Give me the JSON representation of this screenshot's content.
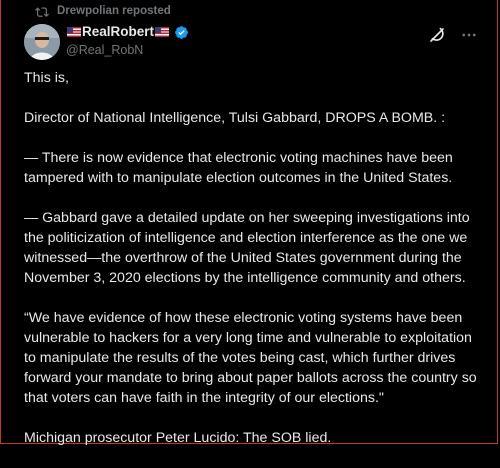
{
  "repost": {
    "icon": "repost-icon",
    "text": "Drewpolian reposted"
  },
  "author": {
    "display_name": "RealRobert",
    "handle": "@Real_RobN",
    "verified_color": "#1d9bf0"
  },
  "actions": {
    "grok_icon": "grok-icon",
    "more_icon": "more-icon"
  },
  "post": {
    "paragraphs": [
      "This is,",
      "Director of National Intelligence, Tulsi Gabbard, DROPS A BOMB. :",
      "— There is now evidence that electronic voting machines have been tampered with to manipulate election outcomes in the United States.",
      "— Gabbard gave a detailed update on her sweeping investigations into the politicization of intelligence and election interference as the one we witnessed—the overthrow of the United States government during the November 3, 2020 elections by the intelligence community and others.",
      "“We have evidence of how these electronic voting systems have been vulnerable to hackers for a very long time and vulnerable to exploitation to manipulate the results of the votes being cast, which further drives forward your mandate to bring about paper ballots across the country so that voters can have faith in the integrity of our elections.\"",
      "Michigan prosecutor Peter Lucido: The SOB lied."
    ]
  },
  "colors": {
    "background": "#000000",
    "text": "#e7e9ea",
    "muted": "#71767b",
    "frame_border": "#c0392b"
  }
}
